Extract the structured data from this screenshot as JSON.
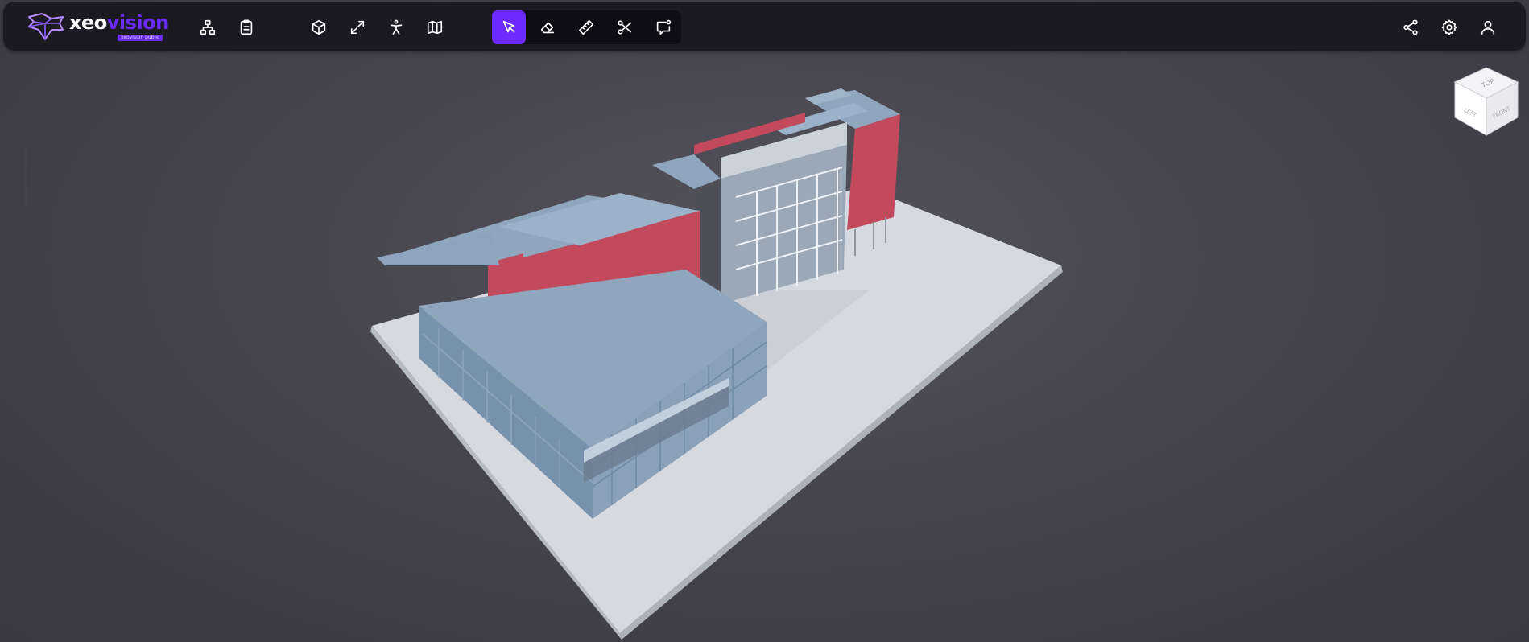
{
  "app": {
    "logo_part1": "xeo",
    "logo_part2": "vision",
    "logo_badge": "xeovision public"
  },
  "toolbar": {
    "left_tools": [
      {
        "name": "tree-view-button",
        "icon": "hierarchy-icon"
      },
      {
        "name": "properties-button",
        "icon": "clipboard-icon"
      }
    ],
    "view_tools": [
      {
        "name": "3d-view-button",
        "icon": "cube-icon"
      },
      {
        "name": "fit-view-button",
        "icon": "expand-icon"
      },
      {
        "name": "first-person-button",
        "icon": "person-icon"
      },
      {
        "name": "plan-view-button",
        "icon": "map-icon"
      }
    ],
    "interaction_tools": [
      {
        "name": "select-tool-button",
        "icon": "cursor-icon",
        "active": true
      },
      {
        "name": "hide-tool-button",
        "icon": "eraser-icon",
        "active": false
      },
      {
        "name": "measure-tool-button",
        "icon": "ruler-icon",
        "active": false
      },
      {
        "name": "section-tool-button",
        "icon": "scissors-icon",
        "active": false
      },
      {
        "name": "annotate-tool-button",
        "icon": "comment-icon",
        "active": false
      }
    ],
    "right_tools": [
      {
        "name": "share-button",
        "icon": "share-icon"
      },
      {
        "name": "settings-button",
        "icon": "gear-icon"
      },
      {
        "name": "user-button",
        "icon": "user-icon"
      }
    ]
  },
  "navcube": {
    "top_label": "TOP",
    "left_label": "LEFT",
    "front_label": "FRONT"
  },
  "colors": {
    "accent": "#6b2bff",
    "toolbar_bg": "#1b1a22",
    "roof": "#8fa6bd",
    "wall_red": "#c24a5c",
    "ground": "#d6d9e0"
  }
}
